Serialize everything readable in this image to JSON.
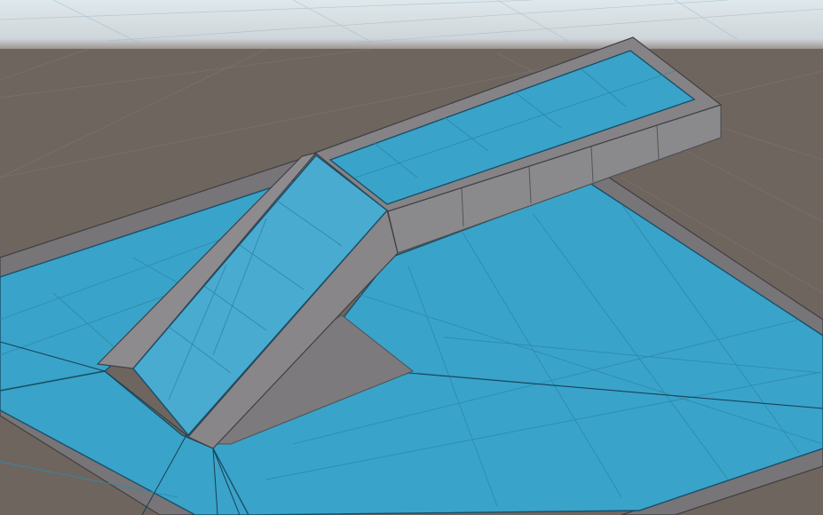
{
  "scene": {
    "view": "scene-viewport",
    "ground_color": "#6e655f",
    "sky_color": "#d9e1e5",
    "navmesh_color": "#3aa3c9",
    "navmesh_edge_color": "#1a4f68",
    "wall_color": "#8a8a8d",
    "wall_dark_color": "#5c5c60",
    "objects": [
      "navmesh-floor",
      "raised-walkway",
      "ramp",
      "floor-border"
    ]
  }
}
